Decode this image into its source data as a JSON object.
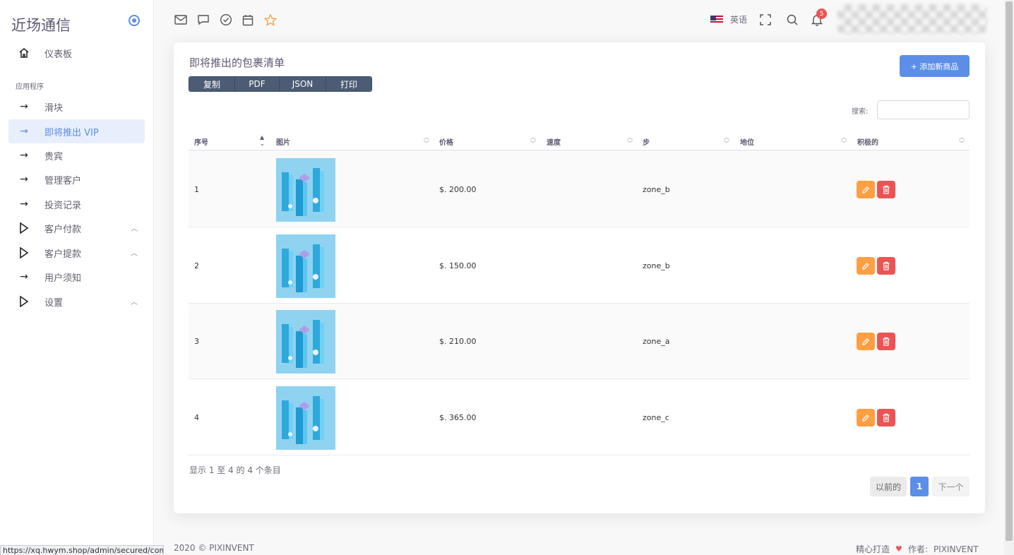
{
  "brand": "近场通信",
  "sidebar": {
    "top_item": "仪表板",
    "section": "应用程序",
    "items": [
      {
        "label": "滑块",
        "chev": ""
      },
      {
        "label": "即将推出 VIP",
        "chev": ""
      },
      {
        "label": "贵宾",
        "chev": ""
      },
      {
        "label": "管理客户",
        "chev": ""
      },
      {
        "label": "投资记录",
        "chev": ""
      },
      {
        "label": "客户付款",
        "chev": "^"
      },
      {
        "label": "客户提款",
        "chev": "^"
      },
      {
        "label": "用户须知",
        "chev": ""
      },
      {
        "label": "设置",
        "chev": "^"
      }
    ]
  },
  "status_url": "https://xq.hwym.shop/admin/secured/coming",
  "topbar": {
    "language": "英语",
    "notification_count": "5"
  },
  "card": {
    "title": "即将推出的包裹清单",
    "buttons": [
      "复制",
      "PDF",
      "JSON",
      "打印"
    ],
    "add_button": "+ 添加新商品",
    "search_label": "搜索:",
    "search_value": ""
  },
  "table": {
    "headers": [
      "序号",
      "图片",
      "价格",
      "速度",
      "步",
      "地位",
      "积极的"
    ],
    "rows": [
      {
        "id": "1",
        "price": "$. 200.00",
        "speed": "",
        "step": "zone_b",
        "status": ""
      },
      {
        "id": "2",
        "price": "$. 150.00",
        "speed": "",
        "step": "zone_b",
        "status": ""
      },
      {
        "id": "3",
        "price": "$. 210.00",
        "speed": "",
        "step": "zone_a",
        "status": ""
      },
      {
        "id": "4",
        "price": "$. 365.00",
        "speed": "",
        "step": "zone_c",
        "status": ""
      }
    ]
  },
  "pagination": {
    "info": "显示 1 至 4 的 4 个条目",
    "prev": "以前的",
    "current": "1",
    "next": "下一个"
  },
  "footer": {
    "copyright": "2020 © PIXINVENT",
    "made_with": "精心打造",
    "by": "作者:",
    "author": "PIXINVENT"
  },
  "colors": {
    "accent": "#5c8ee8",
    "edit": "#ff9f43",
    "delete": "#ea5455"
  }
}
